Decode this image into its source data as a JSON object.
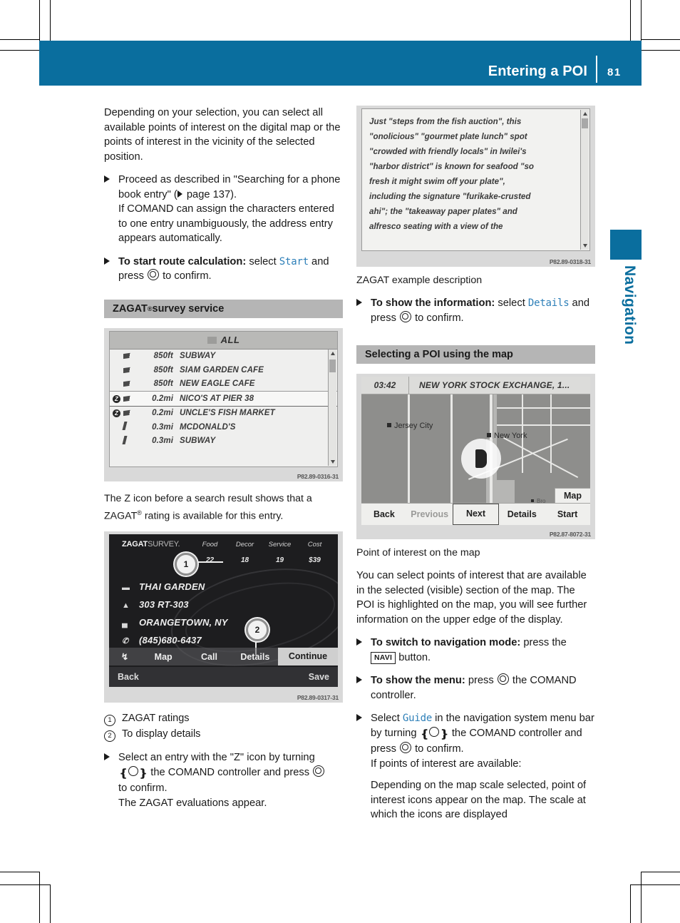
{
  "header": {
    "title": "Entering a POI",
    "page_number": "81"
  },
  "side_tab": {
    "label": "Navigation"
  },
  "left_column": {
    "intro_paragraph": "Depending on your selection, you can select all available points of interest on the digital map or the points of interest in the vicinity of the selected position.",
    "step1_line1": "Proceed as described in \"Searching for a phone book entry\" (",
    "step1_pageref": " page 137).",
    "step1_rest": "If COMAND can assign the characters entered to one entry unambiguously, the address entry appears automatically.",
    "step2_bold": "To start route calculation:",
    "step2_text_before": " select ",
    "step2_command": "Start",
    "step2_text_after": " and press ",
    "step2_text_end": " to confirm.",
    "section_heading": "ZAGAT",
    "section_heading_sup": "®",
    "section_heading_rest": " survey service",
    "z_icon_paragraph_a": "The Z icon before a search result shows that a",
    "z_icon_paragraph_b": "ZAGAT",
    "z_icon_paragraph_sup": "®",
    "z_icon_paragraph_c": " rating is available for this entry.",
    "legend": [
      {
        "num": "1",
        "text": "ZAGAT ratings"
      },
      {
        "num": "2",
        "text": "To display details"
      }
    ],
    "step3_before": "Select an entry with the \"Z\" icon by turning ",
    "step3_mid": " the COMAND controller and press ",
    "step3_after": " to confirm.",
    "step3_result": "The ZAGAT evaluations appear."
  },
  "right_column": {
    "caption_desc": "ZAGAT example description",
    "step_info_bold": "To show the information:",
    "step_info_before": " select ",
    "step_info_command": "Details",
    "step_info_mid": " and press ",
    "step_info_after": " to confirm.",
    "section_heading": "Selecting a POI using the map",
    "caption_map": "Point of interest on the map",
    "body_paragraph": "You can select points of interest that are available in the selected (visible) section of the map. The POI is highlighted on the map, you will see further information on the upper edge of the display.",
    "step_nav_bold": "To switch to navigation mode:",
    "step_nav_text": " press the ",
    "step_nav_key": "NAVI",
    "step_nav_end": " button.",
    "step_menu_bold": "To show the menu:",
    "step_menu_before": " press ",
    "step_menu_after": " the COMAND controller.",
    "step_guide_before": "Select ",
    "step_guide_command": "Guide",
    "step_guide_mid1": " in the navigation system menu bar by turning ",
    "step_guide_mid2": " the COMAND controller and press ",
    "step_guide_mid3": " to confirm.",
    "step_guide_cond": "If points of interest are available:",
    "step_guide_tail": "Depending on the map scale selected, point of interest icons appear on the map. The scale at which the icons are displayed"
  },
  "screenshots": {
    "zagat_description": {
      "code": "P82.89-0318-31",
      "lines": [
        "Just \"steps from the fish auction\", this",
        "\"onolicious\" \"gourmet plate lunch\" spot",
        "\"crowded with friendly locals\" in Iwilei's",
        "\"harbor district\" is known for seafood \"so",
        "fresh it might swim off your plate\",",
        "including the signature \"furikake-crusted",
        "ahi\"; the \"takeaway paper plates\" and",
        "alfresco seating with a view of the"
      ]
    },
    "poi_list": {
      "code": "P82.89-0316-31",
      "title": "ALL",
      "rows": [
        {
          "z": "",
          "icon": "turn-right-icon",
          "distance": "850ft",
          "name": "SUBWAY",
          "selected": false
        },
        {
          "z": "",
          "icon": "turn-right-icon",
          "distance": "850ft",
          "name": "SIAM GARDEN CAFE",
          "selected": false
        },
        {
          "z": "",
          "icon": "turn-right-icon",
          "distance": "850ft",
          "name": "NEW EAGLE CAFE",
          "selected": false
        },
        {
          "z": "Z",
          "icon": "turn-right-icon",
          "distance": "0.2mi",
          "name": "NICO'S AT PIER 38",
          "selected": true
        },
        {
          "z": "Z",
          "icon": "turn-right-icon",
          "distance": "0.2mi",
          "name": "UNCLE'S FISH MARKET",
          "selected": false
        },
        {
          "z": "",
          "icon": "straight-icon",
          "distance": "0.3mi",
          "name": "MCDONALD'S",
          "selected": false
        },
        {
          "z": "",
          "icon": "straight-icon",
          "distance": "0.3mi",
          "name": "SUBWAY",
          "selected": false
        }
      ]
    },
    "zagat_card": {
      "code": "P82.89-0317-31",
      "brand_bold": "ZAGAT",
      "brand_light": "SURVEY.",
      "rating_headers": [
        "Food",
        "Decor",
        "Service",
        "Cost"
      ],
      "rating_values": [
        "22",
        "18",
        "19",
        "$39"
      ],
      "callout_1": "1",
      "callout_2": "2",
      "name": "THAI GARDEN",
      "street": "303 RT-303",
      "city": "ORANGETOWN, NY",
      "phone": "(845)680-6437",
      "menu": [
        "Map",
        "Call",
        "Details"
      ],
      "menu_highlight": "Continue",
      "bottom_left": "Back",
      "bottom_right": "Save"
    },
    "map": {
      "code": "P82.87-8072-31",
      "time": "03:42",
      "poi_name": "NEW YORK STOCK EXCHANGE, 1...",
      "labels": [
        "Jersey City",
        "New York",
        "Bro"
      ],
      "map_button": "Map",
      "menu": [
        "Back",
        "Previous",
        "Next",
        "Details",
        "Start"
      ],
      "menu_dim": "Previous",
      "menu_selected": "Next"
    }
  },
  "colors": {
    "brand_blue": "#0a6e9e",
    "command_blue": "#2d7fb8",
    "heading_gray": "#b5b5b5"
  }
}
